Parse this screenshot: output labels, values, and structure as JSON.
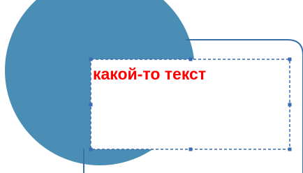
{
  "canvas": {
    "text_box": {
      "text": "какой-то текст",
      "text_color": "#ff0000"
    },
    "circle_color": "#4a8db5",
    "outline_color": "#3a6fa8",
    "selection_color": "#3a6ab0"
  }
}
